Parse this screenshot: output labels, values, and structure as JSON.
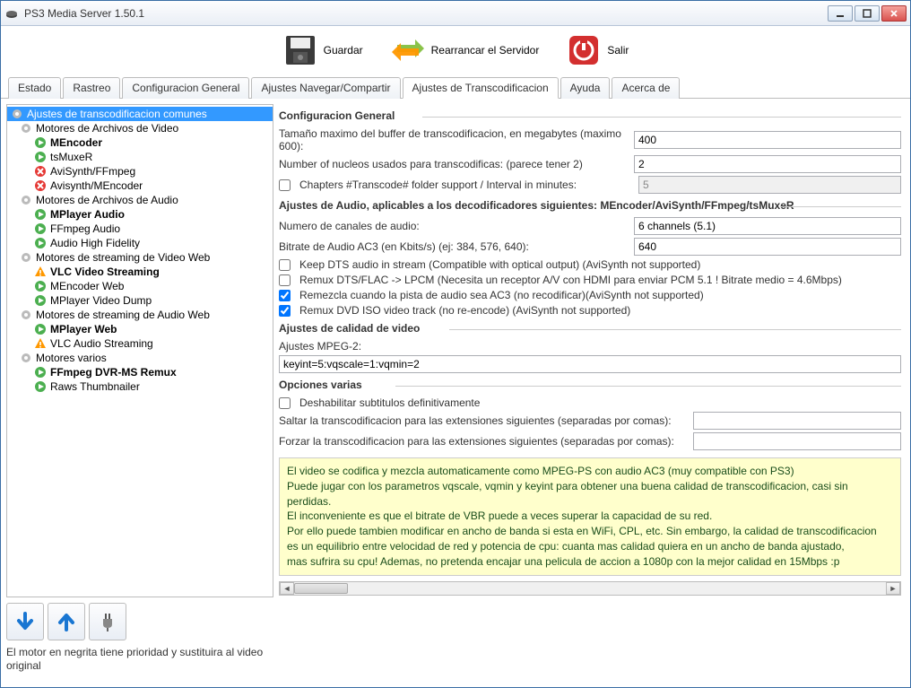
{
  "window": {
    "title": "PS3 Media Server 1.50.1"
  },
  "toolbar": {
    "save": "Guardar",
    "restart": "Rearrancar el Servidor",
    "quit": "Salir"
  },
  "tabs": [
    "Estado",
    "Rastreo",
    "Configuracion General",
    "Ajustes Navegar/Compartir",
    "Ajustes de Transcodificacion",
    "Ayuda",
    "Acerca de"
  ],
  "tree": {
    "root": "Ajustes de transcodificacion comunes",
    "groups": [
      {
        "label": "Motores de Archivos de Video",
        "items": [
          {
            "label": "MEncoder",
            "bold": true,
            "icon": "play"
          },
          {
            "label": "tsMuxeR",
            "icon": "play"
          },
          {
            "label": "AviSynth/FFmpeg",
            "icon": "error"
          },
          {
            "label": "Avisynth/MEncoder",
            "icon": "error"
          }
        ]
      },
      {
        "label": "Motores de Archivos de Audio",
        "items": [
          {
            "label": "MPlayer Audio",
            "bold": true,
            "icon": "play"
          },
          {
            "label": "FFmpeg Audio",
            "icon": "play"
          },
          {
            "label": "Audio High Fidelity",
            "icon": "play"
          }
        ]
      },
      {
        "label": "Motores de streaming de Video Web",
        "items": [
          {
            "label": "VLC Video Streaming",
            "bold": true,
            "icon": "warn"
          },
          {
            "label": "MEncoder Web",
            "icon": "play"
          },
          {
            "label": "MPlayer Video Dump",
            "icon": "play"
          }
        ]
      },
      {
        "label": "Motores de streaming de Audio Web",
        "items": [
          {
            "label": "MPlayer Web",
            "bold": true,
            "icon": "play"
          },
          {
            "label": "VLC Audio Streaming",
            "icon": "warn"
          }
        ]
      },
      {
        "label": "Motores varios",
        "items": [
          {
            "label": "FFmpeg DVR-MS Remux",
            "bold": true,
            "icon": "play"
          },
          {
            "label": "Raws Thumbnailer",
            "icon": "play"
          }
        ]
      }
    ]
  },
  "leftnote": "El motor en negrita tiene prioridad y sustituira al video original",
  "sections": {
    "general": {
      "title": "Configuracion General",
      "buffer_label": "Tamaño maximo del buffer de transcodificacion, en megabytes (maximo 600):",
      "buffer_value": "400",
      "cores_label": "Number of nucleos usados para transcodificas: (parece tener 2)",
      "cores_value": "2",
      "chapters_label": "Chapters #Transcode# folder support / Interval in minutes:",
      "chapters_value": "5"
    },
    "audio": {
      "title": "Ajustes de Audio, aplicables a los decodificadores siguientes: MEncoder/AviSynth/FFmpeg/tsMuxeR",
      "channels_label": "Numero de canales de audio:",
      "channels_value": "6 channels (5.1)",
      "bitrate_label": "Bitrate de Audio AC3 (en Kbits/s) (ej: 384, 576, 640):",
      "bitrate_value": "640",
      "cb1": "Keep DTS audio in stream (Compatible with optical output) (AviSynth not supported)",
      "cb2": "Remux DTS/FLAC -> LPCM (Necesita un receptor A/V con HDMI para enviar PCM 5.1 ! Bitrate medio = 4.6Mbps)",
      "cb3": "Remezcla cuando la pista de audio sea AC3 (no recodificar)(AviSynth not supported)",
      "cb4": "Remux DVD ISO video track (no re-encode) (AviSynth not supported)"
    },
    "video": {
      "title": "Ajustes de calidad de video",
      "mpeg2_label": "Ajustes MPEG-2:",
      "mpeg2_value": "keyint=5:vqscale=1:vqmin=2"
    },
    "misc": {
      "title": "Opciones varias",
      "cb_subs": "Deshabilitar subtitulos definitivamente",
      "skip_label": "Saltar la transcodificacion para las extensiones siguientes (separadas por comas):",
      "skip_value": "",
      "force_label": "Forzar la transcodificacion para las extensiones siguientes (separadas por comas):",
      "force_value": ""
    },
    "help": "El video se codifica y mezcla automaticamente como MPEG-PS con audio AC3 (muy compatible con PS3)\nPuede jugar con los parametros vqscale, vqmin y keyint para obtener una buena calidad de transcodificacion, casi sin perdidas.\nEl inconveniente es que el bitrate de VBR puede a veces superar la capacidad de su red.\nPor ello puede tambien modificar en ancho de banda si esta en WiFi, CPL, etc. Sin embargo, la calidad de transcodificacion\nes un equilibrio entre velocidad de red y potencia de cpu: cuanta mas calidad quiera en un ancho de banda ajustado,\nmas sufrira su cpu! Ademas, no pretenda encajar una pelicula de accion a 1080p con la mejor calidad en 15Mbps :p"
  }
}
